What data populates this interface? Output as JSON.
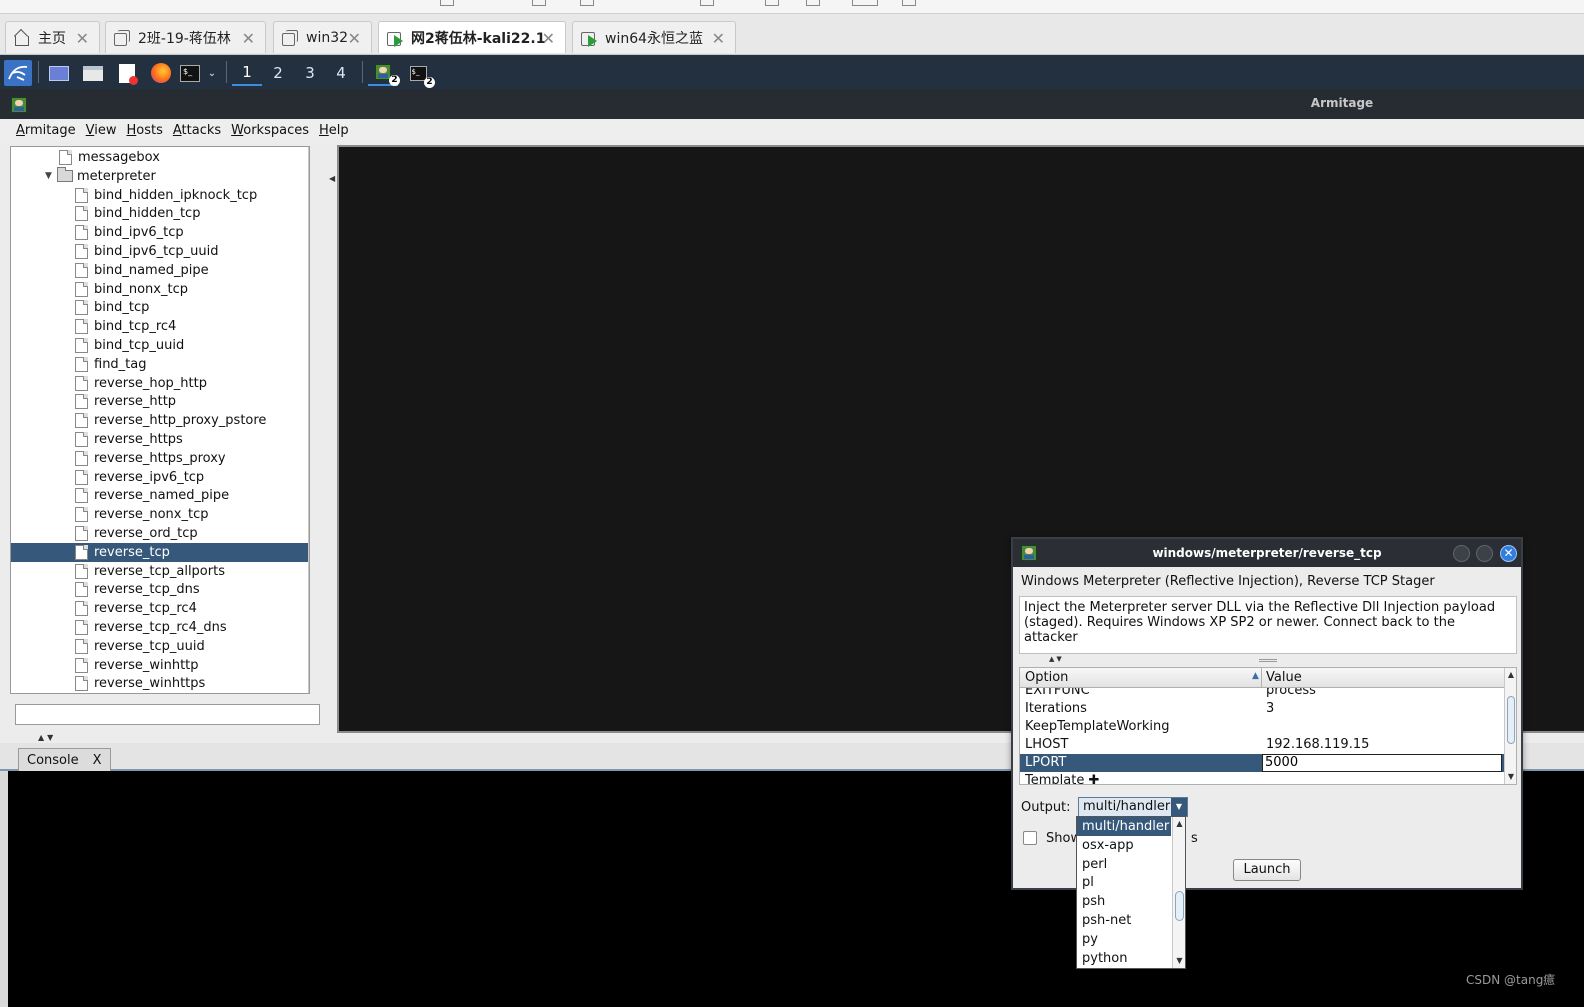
{
  "vm_tabs": [
    {
      "label": "主页",
      "icon": "home-icon"
    },
    {
      "label": "2班-19-蒋伍林",
      "icon": "vm-icon"
    },
    {
      "label": "win32",
      "icon": "vm-icon"
    },
    {
      "label": "网2蒋伍林-kali22.1",
      "icon": "vm-running-icon"
    },
    {
      "label": "win64永恒之蓝",
      "icon": "vm-running-icon"
    }
  ],
  "panel": {
    "workspaces": [
      "1",
      "2",
      "3",
      "4"
    ],
    "active_workspace": "1",
    "badge_count": "2"
  },
  "window": {
    "title": "Armitage"
  },
  "menu": {
    "items": [
      {
        "label": "Armitage",
        "mnemonic": "A",
        "rest": "rmitage"
      },
      {
        "label": "View",
        "mnemonic": "V",
        "rest": "iew"
      },
      {
        "label": "Hosts",
        "mnemonic": "H",
        "rest": "osts"
      },
      {
        "label": "Attacks",
        "mnemonic": "A",
        "rest": "ttacks"
      },
      {
        "label": "Workspaces",
        "mnemonic": "W",
        "rest": "orkspaces"
      },
      {
        "label": "Help",
        "mnemonic": "H",
        "rest": "elp"
      }
    ]
  },
  "tree": {
    "items": [
      {
        "label": "messagebox",
        "type": "file",
        "level": 1
      },
      {
        "label": "meterpreter",
        "type": "folder",
        "level": 1,
        "expanded": true
      },
      {
        "label": "bind_hidden_ipknock_tcp",
        "type": "file",
        "level": 2
      },
      {
        "label": "bind_hidden_tcp",
        "type": "file",
        "level": 2
      },
      {
        "label": "bind_ipv6_tcp",
        "type": "file",
        "level": 2
      },
      {
        "label": "bind_ipv6_tcp_uuid",
        "type": "file",
        "level": 2
      },
      {
        "label": "bind_named_pipe",
        "type": "file",
        "level": 2
      },
      {
        "label": "bind_nonx_tcp",
        "type": "file",
        "level": 2
      },
      {
        "label": "bind_tcp",
        "type": "file",
        "level": 2
      },
      {
        "label": "bind_tcp_rc4",
        "type": "file",
        "level": 2
      },
      {
        "label": "bind_tcp_uuid",
        "type": "file",
        "level": 2
      },
      {
        "label": "find_tag",
        "type": "file",
        "level": 2
      },
      {
        "label": "reverse_hop_http",
        "type": "file",
        "level": 2
      },
      {
        "label": "reverse_http",
        "type": "file",
        "level": 2
      },
      {
        "label": "reverse_http_proxy_pstore",
        "type": "file",
        "level": 2
      },
      {
        "label": "reverse_https",
        "type": "file",
        "level": 2
      },
      {
        "label": "reverse_https_proxy",
        "type": "file",
        "level": 2
      },
      {
        "label": "reverse_ipv6_tcp",
        "type": "file",
        "level": 2
      },
      {
        "label": "reverse_named_pipe",
        "type": "file",
        "level": 2
      },
      {
        "label": "reverse_nonx_tcp",
        "type": "file",
        "level": 2
      },
      {
        "label": "reverse_ord_tcp",
        "type": "file",
        "level": 2
      },
      {
        "label": "reverse_tcp",
        "type": "file",
        "level": 2,
        "selected": true
      },
      {
        "label": "reverse_tcp_allports",
        "type": "file",
        "level": 2
      },
      {
        "label": "reverse_tcp_dns",
        "type": "file",
        "level": 2
      },
      {
        "label": "reverse_tcp_rc4",
        "type": "file",
        "level": 2
      },
      {
        "label": "reverse_tcp_rc4_dns",
        "type": "file",
        "level": 2
      },
      {
        "label": "reverse_tcp_uuid",
        "type": "file",
        "level": 2
      },
      {
        "label": "reverse_winhttp",
        "type": "file",
        "level": 2
      },
      {
        "label": "reverse_winhttps",
        "type": "file",
        "level": 2
      }
    ],
    "search_value": ""
  },
  "console": {
    "tab_label": "Console",
    "close_label": "X"
  },
  "dialog": {
    "title": "windows/meterpreter/reverse_tcp",
    "close_glyph": "✕",
    "name": "Windows Meterpreter (Reflective Injection), Reverse TCP Stager",
    "description": "Inject the Meterpreter server DLL via the Reflective Dll Injection payload\n(staged). Requires Windows XP SP2 or newer. Connect back to the attacker",
    "table": {
      "col_option": "Option",
      "col_value": "Value",
      "rows": [
        {
          "option": "EXITFUNC",
          "value": "process",
          "cut": true
        },
        {
          "option": "Iterations",
          "value": "3"
        },
        {
          "option": "KeepTemplateWorking",
          "value": ""
        },
        {
          "option": "LHOST",
          "value": "192.168.119.15"
        },
        {
          "option": "LPORT",
          "value": "5000",
          "selected": true
        },
        {
          "option": "Template ✚",
          "value": ""
        }
      ]
    },
    "output_label": "Output:",
    "output_value": "multi/handler",
    "show_label": "Show",
    "show_label_tail": "s",
    "launch_label": "Launch"
  },
  "dropdown": {
    "options": [
      "multi/handler",
      "osx-app",
      "perl",
      "pl",
      "psh",
      "psh-net",
      "py",
      "python"
    ],
    "selected": "multi/handler"
  },
  "watermark": "CSDN @tang癔",
  "colors": {
    "selection": "#36587a",
    "panel": "#23303f",
    "accent": "#2f7fe0"
  }
}
